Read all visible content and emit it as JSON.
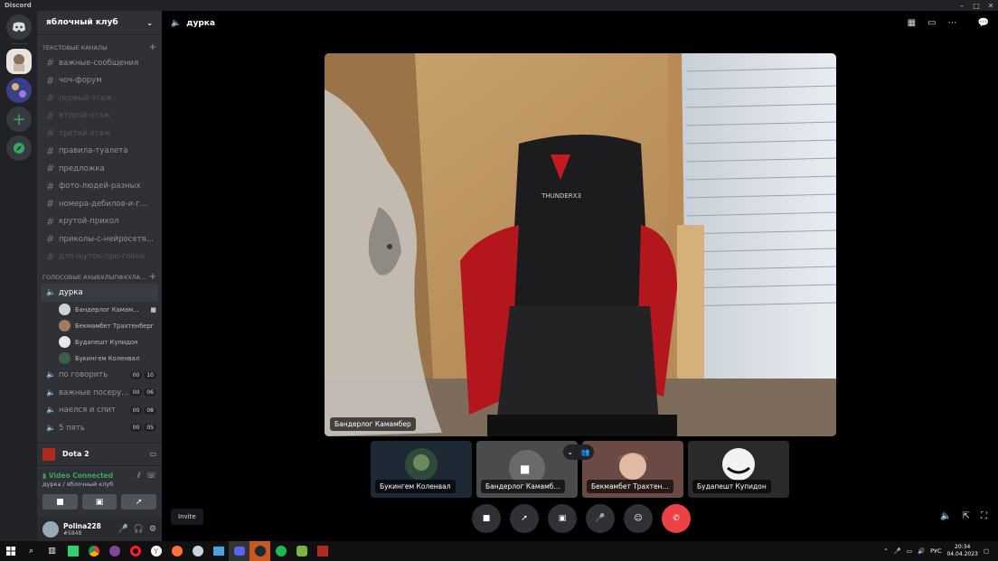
{
  "window": {
    "app_name": "Discord"
  },
  "server": {
    "name": "яблочный клуб"
  },
  "sidebar": {
    "text_category": "ТЕКСТОВЫЕ КАНАЛЫ",
    "text_channels": [
      {
        "label": "важные-сообщения",
        "muted": false
      },
      {
        "label": "чоч-форум",
        "muted": false
      },
      {
        "label": "первый-этаж",
        "muted": true
      },
      {
        "label": "второй-этаж",
        "muted": true
      },
      {
        "label": "третий-этаж",
        "muted": true
      },
      {
        "label": "правила-туалета",
        "muted": false
      },
      {
        "label": "предложка",
        "muted": false
      },
      {
        "label": "фото-людей-разных",
        "muted": false
      },
      {
        "label": "номера-дебилов-и-г...",
        "muted": false
      },
      {
        "label": "крутой-прикол",
        "muted": false
      },
      {
        "label": "приколы-с-нейросетя...",
        "muted": false
      },
      {
        "label": "для-шуток-про-говно",
        "muted": true
      }
    ],
    "voice_category": "ГОЛОСОВЫЕ АХЫВХЛЫПФХХЛА...",
    "active_voice": "дурка",
    "voice_users": [
      "Бандерлог Камам...",
      "Бекмамбет Трахтенберг",
      "Будапешт Купидон",
      "Букингем Коленвал"
    ],
    "voice_channels": [
      {
        "label": "по говорить",
        "a": "00",
        "b": "10"
      },
      {
        "label": "важные посеру...",
        "a": "00",
        "b": "06"
      },
      {
        "label": "наелся и спит",
        "a": "00",
        "b": "08"
      },
      {
        "label": "5 пять",
        "a": "00",
        "b": "05"
      }
    ]
  },
  "game": {
    "name": "Dota 2"
  },
  "rtc": {
    "status": "Video Connected",
    "location": "дурка / яблочный клуб"
  },
  "user": {
    "name": "Polina228",
    "tag": "#5848"
  },
  "tooltip": "Invite",
  "stage": {
    "channel": "дурка",
    "main_label": "Бандерлог Камамбер",
    "tiles": [
      "Букингем Коленвал",
      "Бандерлог Камамб...",
      "Бекмамбет Трахтен...",
      "Будапешт Купидон"
    ]
  },
  "chair_brand": "THUNDERX3",
  "tray": {
    "lang": "РУС",
    "time": "20:34",
    "date": "04.04.2023"
  },
  "colors": {
    "accent": "#5865f2",
    "green": "#3ba55d",
    "red": "#ed4245"
  }
}
